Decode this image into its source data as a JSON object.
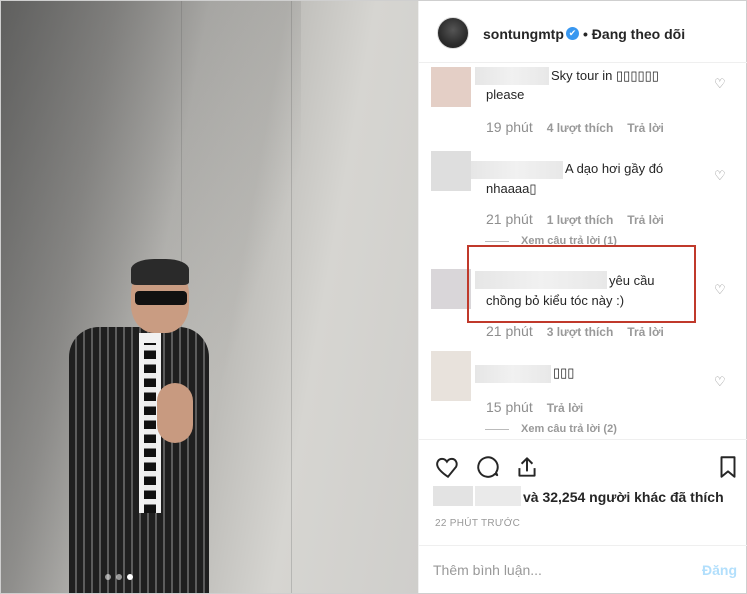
{
  "header": {
    "username": "sontungmtp",
    "following_label": "• Đang theo dõi"
  },
  "comments": [
    {
      "text_line1": "Sky tour in ▯▯▯▯▯▯",
      "text_line2": "please",
      "time": "19 phút",
      "likes": "4 lượt thích",
      "reply": "Trả lời"
    },
    {
      "text_line1": "A dạo hơi gầy đó",
      "text_line2": "nhaaaa▯",
      "time": "21 phút",
      "likes": "1 lượt thích",
      "reply": "Trả lời",
      "view_replies": "Xem câu trả lời (1)"
    },
    {
      "text_line1": "yêu cầu",
      "text_line2": "chồng bỏ kiểu tóc này :)",
      "time": "21 phút",
      "likes": "3 lượt thích",
      "reply": "Trả lời"
    },
    {
      "text_line1": "▯▯▯",
      "time": "15 phút",
      "reply": "Trả lời",
      "view_replies": "Xem câu trả lời (2)"
    }
  ],
  "likes_summary": "và 32,254 người khác đã thích",
  "time_ago": "22 PHÚT TRƯỚC",
  "add_comment": {
    "placeholder": "Thêm bình luận...",
    "post_label": "Đăng"
  },
  "icons": [
    "heart-icon",
    "comment-icon",
    "share-icon",
    "bookmark-icon",
    "verified-icon"
  ],
  "colors": {
    "verified": "#3897f0",
    "highlight_border": "#c0392b",
    "post_disabled": "#b2dffc"
  }
}
